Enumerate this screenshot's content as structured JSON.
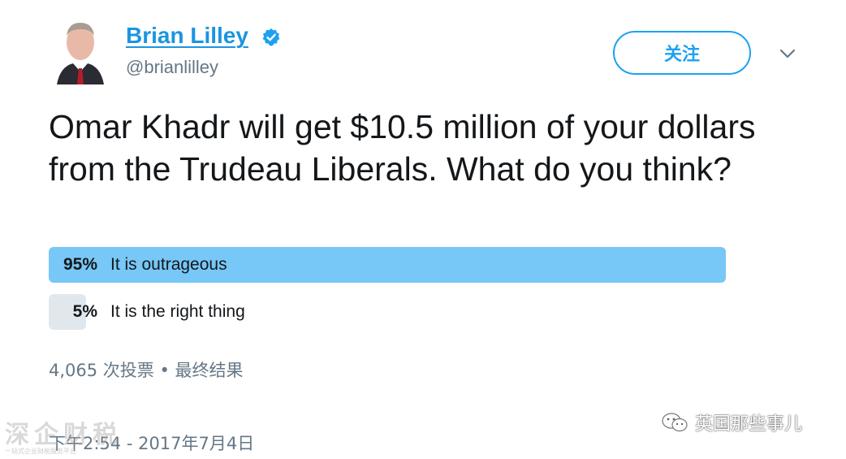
{
  "profile": {
    "name": "Brian Lilley",
    "handle": "@brianlilley",
    "verified": true,
    "avatar_icon": "avatar-photo"
  },
  "follow_button": {
    "label": "关注"
  },
  "more_menu_icon": "chevron-down-icon",
  "tweet": {
    "text": "Omar Khadr will get $10.5 million of your dollars from the Trudeau Liberals. What do you think?"
  },
  "poll": {
    "options": [
      {
        "percent_label": "95%",
        "percent": 95,
        "label": "It is outrageous",
        "winner": true
      },
      {
        "percent_label": "5%",
        "percent": 5,
        "label": "It is the right thing",
        "winner": false
      }
    ],
    "meta": "4,065 次投票 • 最终结果"
  },
  "timestamp": "下午2:54 - 2017年7月4日",
  "watermarks": {
    "left": "深企财税",
    "left_sub": "一站式企业财税服务平台",
    "right": "英国那些事儿"
  },
  "colors": {
    "accent": "#1da1f2",
    "link": "#1b95e0",
    "poll_winner": "#77c7f7",
    "poll_loser": "#e1e8ed",
    "secondary_text": "#657786"
  }
}
